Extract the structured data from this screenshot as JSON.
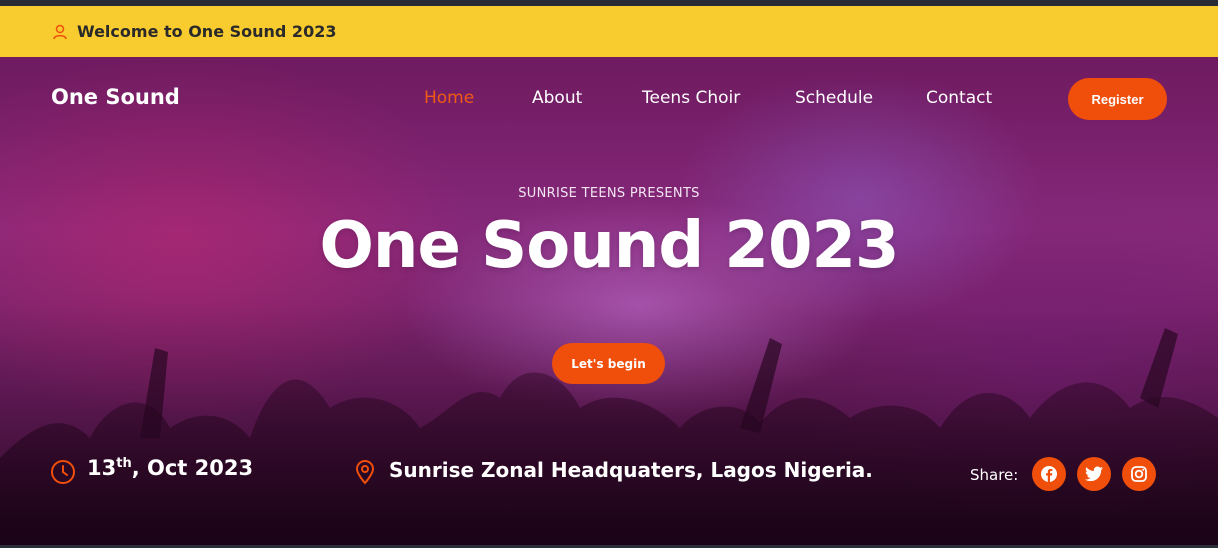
{
  "welcome_bar": {
    "text": "Welcome to One Sound 2023",
    "icon": "user-icon",
    "background": "#f8cb2e"
  },
  "navbar": {
    "brand": "One Sound",
    "items": [
      {
        "label": "Home",
        "active": true
      },
      {
        "label": "About",
        "active": false
      },
      {
        "label": "Teens Choir",
        "active": false
      },
      {
        "label": "Schedule",
        "active": false
      },
      {
        "label": "Contact",
        "active": false
      }
    ],
    "register_label": "Register"
  },
  "hero": {
    "presents": "SUNRISE TEENS PRESENTS",
    "title": "One Sound 2023",
    "cta_label": "Let's begin"
  },
  "event_info": {
    "date_day": "13",
    "date_suffix": "th",
    "date_rest": ", Oct 2023",
    "date_icon": "clock-icon",
    "location": "Sunrise Zonal Headquaters, Lagos Nigeria.",
    "location_icon": "map-pin-icon",
    "share_label": "Share:",
    "social": [
      "facebook-icon",
      "twitter-icon",
      "instagram-icon"
    ]
  },
  "colors": {
    "accent": "#f04e0b",
    "active_nav": "#f15a16",
    "text_light": "#ffffff"
  }
}
